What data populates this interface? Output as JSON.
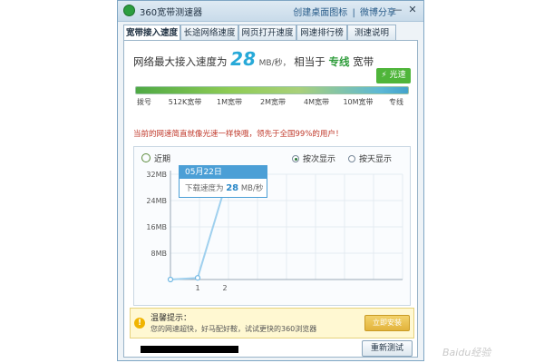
{
  "window": {
    "title": "360宽带测速器",
    "links": [
      "创建桌面图标",
      "|",
      "微博分享"
    ],
    "controls": {
      "minimize": "—",
      "close": "✕"
    }
  },
  "tabs": [
    {
      "label": "宽带接入速度",
      "active": true
    },
    {
      "label": "长途网络速度",
      "active": false
    },
    {
      "label": "网页打开速度",
      "active": false
    },
    {
      "label": "网速排行榜",
      "active": false
    },
    {
      "label": "测速说明",
      "active": false
    }
  ],
  "headline": {
    "prefix": "网络最大接入速度为",
    "speed": "28",
    "unit": "MB/秒，",
    "middle": "相当于",
    "tier": "专线",
    "suffix": "宽带"
  },
  "badge": {
    "label": "光速",
    "icon": "lightning-icon"
  },
  "bandwidth_scale": {
    "ticks": [
      "拨号",
      "512K宽带",
      "1M宽带",
      "2M宽带",
      "4M宽带",
      "10M宽带",
      "专线"
    ],
    "fill_fraction": 1.0
  },
  "note": "当前的网速简直就像光速一样快哦，领先于全国99%的用户！",
  "chart_panel": {
    "recent_label": "近期",
    "view_by_count": "按次显示",
    "view_by_day": "按天显示",
    "selected_view": "按次显示"
  },
  "tooltip": {
    "date": "05月22日",
    "label": "下载速度为",
    "value": "28",
    "unit": "MB/秒"
  },
  "chart_data": {
    "type": "line",
    "x": [
      "",
      "1",
      "2"
    ],
    "values": [
      0,
      0.5,
      28
    ],
    "y_ticks": [
      "32MB",
      "24MB",
      "16MB",
      "8MB"
    ],
    "ylim": [
      0,
      32
    ],
    "grid": true
  },
  "tip": {
    "title": "温馨提示：",
    "text": "您的网速超快，好马配好鞍，试试更快的360浏览器",
    "button": "立即安装"
  },
  "retest_button": "重新测试",
  "watermark": "Baidu经验",
  "colors": {
    "accent": "#27a9d8",
    "green": "#4fb53a",
    "note_red": "#c0392b",
    "line": "#9fd0ee"
  }
}
